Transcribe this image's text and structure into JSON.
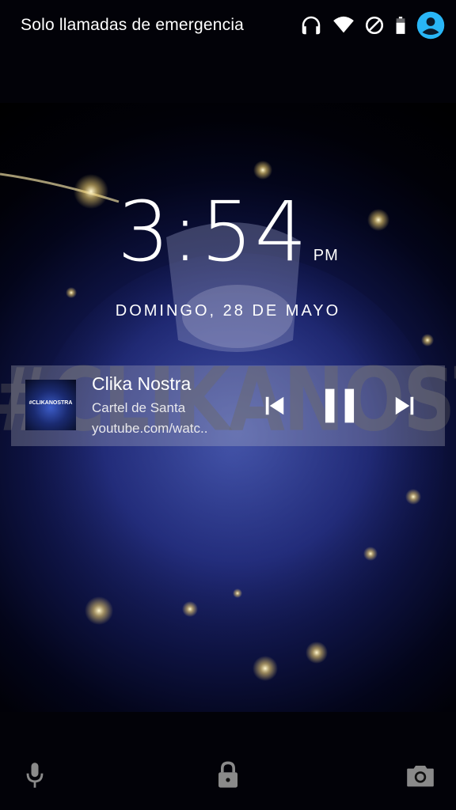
{
  "status_bar": {
    "carrier_text": "Solo llamadas de emergencia",
    "icons": [
      "headphones-icon",
      "wifi-icon",
      "no-sim-icon",
      "battery-icon",
      "user-avatar-icon"
    ]
  },
  "clock": {
    "time": "3:54",
    "ampm": "PM",
    "date": "DOMINGO, 28 DE MAYO"
  },
  "wallpaper": {
    "text": "#CLIKANOSTRA"
  },
  "media": {
    "album_art_text": "#CLIKANOSTRA",
    "title": "Clika Nostra",
    "artist": "Cartel de Santa",
    "source": "youtube.com/watc..",
    "controls": [
      "previous-icon",
      "pause-icon",
      "next-icon"
    ]
  },
  "bottom_bar": {
    "icons": [
      "microphone-icon",
      "lock-icon",
      "camera-icon"
    ]
  },
  "colors": {
    "accent": "#29b6f6",
    "notification_bg": "rgba(200,200,210,0.28)"
  }
}
